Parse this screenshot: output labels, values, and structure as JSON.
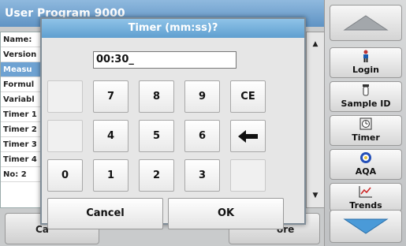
{
  "screen": {
    "title": "User Program 9000",
    "rows": [
      "Name:",
      "Version",
      "Measu",
      "Formul",
      "Variabl",
      "Timer 1",
      "Timer 2",
      "Timer 3",
      "Timer 4",
      "No: 2"
    ],
    "selected_row": 2,
    "bottom_buttons": [
      "Ca",
      "ore"
    ]
  },
  "sidebar": {
    "login": "Login",
    "sample_id": "Sample ID",
    "timer": "Timer",
    "aqa": "AQA",
    "trends": "Trends"
  },
  "dialog": {
    "title": "Timer (mm:ss)?",
    "value": "00:30_",
    "keys": {
      "k7": "7",
      "k8": "8",
      "k9": "9",
      "ce": "CE",
      "k4": "4",
      "k5": "5",
      "k6": "6",
      "k0": "0",
      "k1": "1",
      "k2": "2",
      "k3": "3"
    },
    "cancel": "Cancel",
    "ok": "OK"
  },
  "colors": {
    "title_blue": "#6ea2d2",
    "selected_row": "#6ea2d2"
  }
}
